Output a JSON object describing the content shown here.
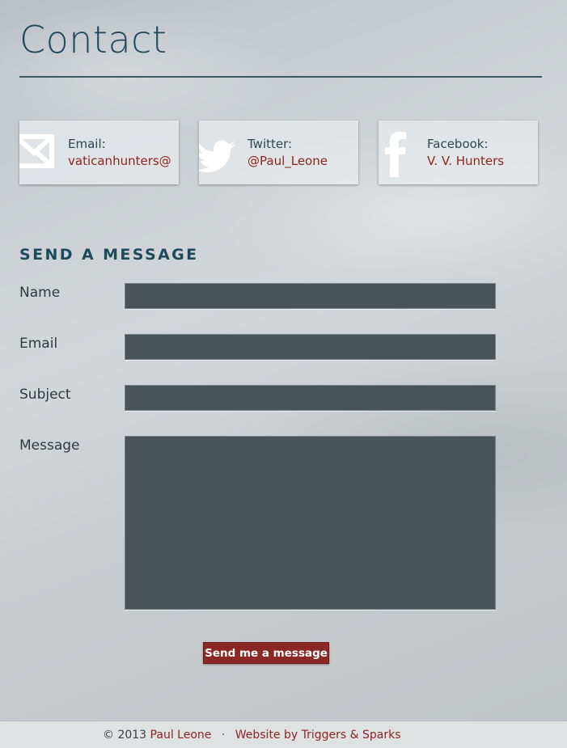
{
  "page": {
    "title": "Contact"
  },
  "contact_cards": {
    "email": {
      "label": "Email:",
      "value": "vaticanhunters@",
      "icon": "email-icon"
    },
    "twitter": {
      "label": "Twitter:",
      "value": "@Paul_Leone",
      "icon": "twitter-bird-icon"
    },
    "facebook": {
      "label": "Facebook:",
      "value": "V. V. Hunters",
      "icon": "facebook-icon"
    }
  },
  "form": {
    "heading": "SEND A MESSAGE",
    "name_label": "Name",
    "name_value": "",
    "email_label": "Email",
    "email_value": "",
    "subject_label": "Subject",
    "subject_value": "",
    "message_label": "Message",
    "message_value": "",
    "submit_label": "Send me a message"
  },
  "footer": {
    "copyright": "© 2013",
    "author": "Paul Leone",
    "separator": "·",
    "credit": "Website by Triggers & Sparks"
  },
  "colors": {
    "accent": "#8b2825",
    "heading": "#1f4a5c",
    "input_bg": "#4a5458"
  }
}
